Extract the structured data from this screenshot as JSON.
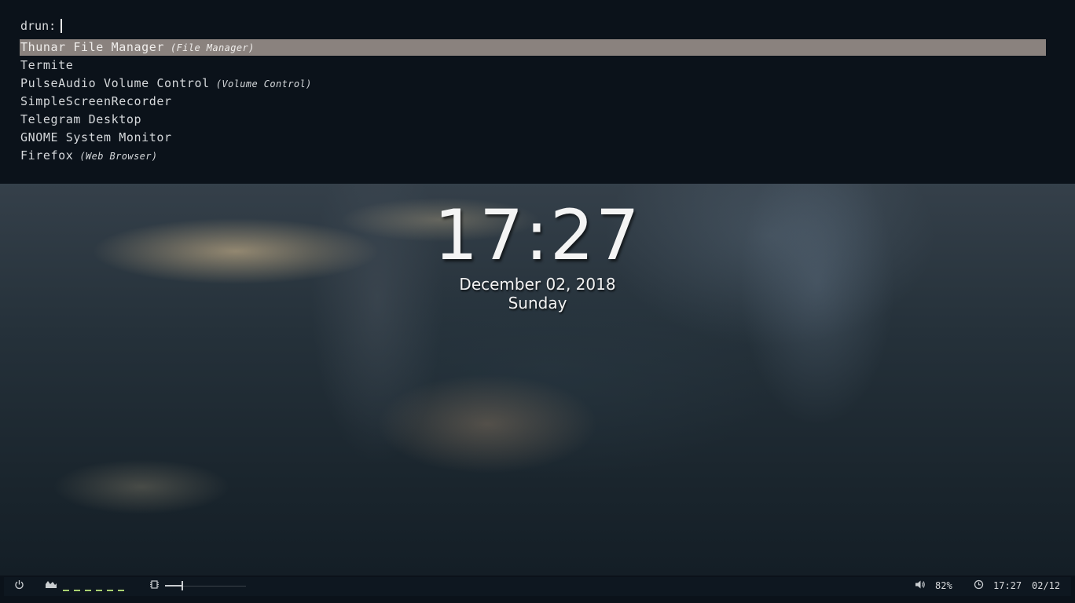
{
  "launcher": {
    "mode_label": "drun:",
    "query": "",
    "entries": [
      {
        "name": "Thunar File Manager",
        "generic": "(File Manager)",
        "selected": true
      },
      {
        "name": "Termite",
        "generic": ""
      },
      {
        "name": "PulseAudio Volume Control",
        "generic": "(Volume Control)"
      },
      {
        "name": "SimpleScreenRecorder",
        "generic": ""
      },
      {
        "name": "Telegram Desktop",
        "generic": ""
      },
      {
        "name": "GNOME System Monitor",
        "generic": ""
      },
      {
        "name": "Firefox",
        "generic": "(Web Browser)"
      }
    ]
  },
  "clock": {
    "time": "17:27",
    "date": "December 02, 2018",
    "day": "Sunday"
  },
  "bar": {
    "power_icon": "power-icon",
    "cpu_icon": "cpu-graph-icon",
    "memory_icon": "memory-chip-icon",
    "memory_fraction": 0.2,
    "volume_icon": "speaker-icon",
    "volume": "82%",
    "clock_icon": "clock-icon",
    "time": "17:27",
    "date": "02/12"
  },
  "colors": {
    "background": "#0b121a",
    "selected_entry": "#8a827e",
    "text": "#d6d9dc",
    "cpu_graph": "#a8d070"
  }
}
